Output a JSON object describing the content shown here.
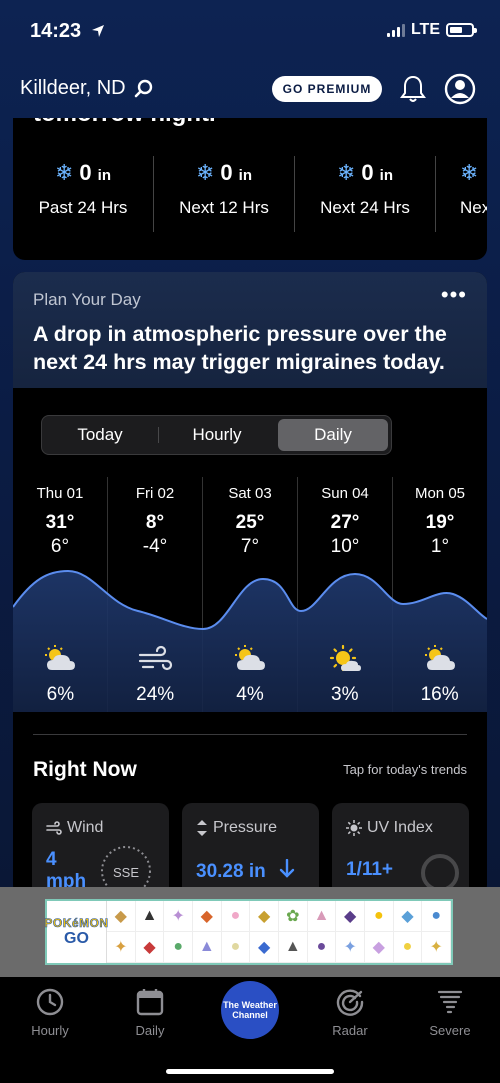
{
  "status": {
    "time": "14:23",
    "network": "LTE"
  },
  "header": {
    "location": "Killdeer, ND",
    "premium_label": "GO PREMIUM"
  },
  "precip": {
    "heading_partial": "tomorrow night.",
    "items": [
      {
        "amount": "0",
        "unit": "in",
        "label": "Past 24 Hrs"
      },
      {
        "amount": "0",
        "unit": "in",
        "label": "Next 12 Hrs"
      },
      {
        "amount": "0",
        "unit": "in",
        "label": "Next 24 Hrs"
      },
      {
        "amount": "",
        "unit": "",
        "label": "Nex"
      }
    ]
  },
  "plan": {
    "title": "Plan Your Day",
    "more_label": "•••",
    "message": "A drop in atmospheric pressure over the next 24 hrs may trigger migraines today."
  },
  "segments": {
    "today": "Today",
    "hourly": "Hourly",
    "daily": "Daily",
    "selected": "Daily"
  },
  "days": [
    {
      "name": "Thu 01",
      "hi": "31°",
      "lo": "6°",
      "icon": "partly-cloudy-icon",
      "precip": "6%"
    },
    {
      "name": "Fri 02",
      "hi": "8°",
      "lo": "-4°",
      "icon": "wind-icon",
      "precip": "24%"
    },
    {
      "name": "Sat 03",
      "hi": "25°",
      "lo": "7°",
      "icon": "partly-cloudy-icon",
      "precip": "4%"
    },
    {
      "name": "Sun 04",
      "hi": "27°",
      "lo": "10°",
      "icon": "sunny-icon",
      "precip": "3%"
    },
    {
      "name": "Mon 05",
      "hi": "19°",
      "lo": "1°",
      "icon": "partly-cloudy-icon",
      "precip": "16%"
    }
  ],
  "right_now": {
    "title": "Right Now",
    "trends_label": "Tap for today's trends",
    "wind": {
      "label": "Wind",
      "value": "4",
      "unit": "mph",
      "direction": "SSE"
    },
    "pressure": {
      "label": "Pressure",
      "value": "30.28 in"
    },
    "uv": {
      "label": "UV Index",
      "value": "1/11+"
    }
  },
  "ad": {
    "brand": "POKéMON",
    "sub": "GO"
  },
  "tabbar": {
    "hourly": "Hourly",
    "daily": "Daily",
    "center": "The Weather Channel",
    "radar": "Radar",
    "severe": "Severe"
  },
  "colors": {
    "accent": "#4a90ff",
    "curve": "#5b8def",
    "snow": "#6cb4ff",
    "brand": "#2a4fc4"
  }
}
